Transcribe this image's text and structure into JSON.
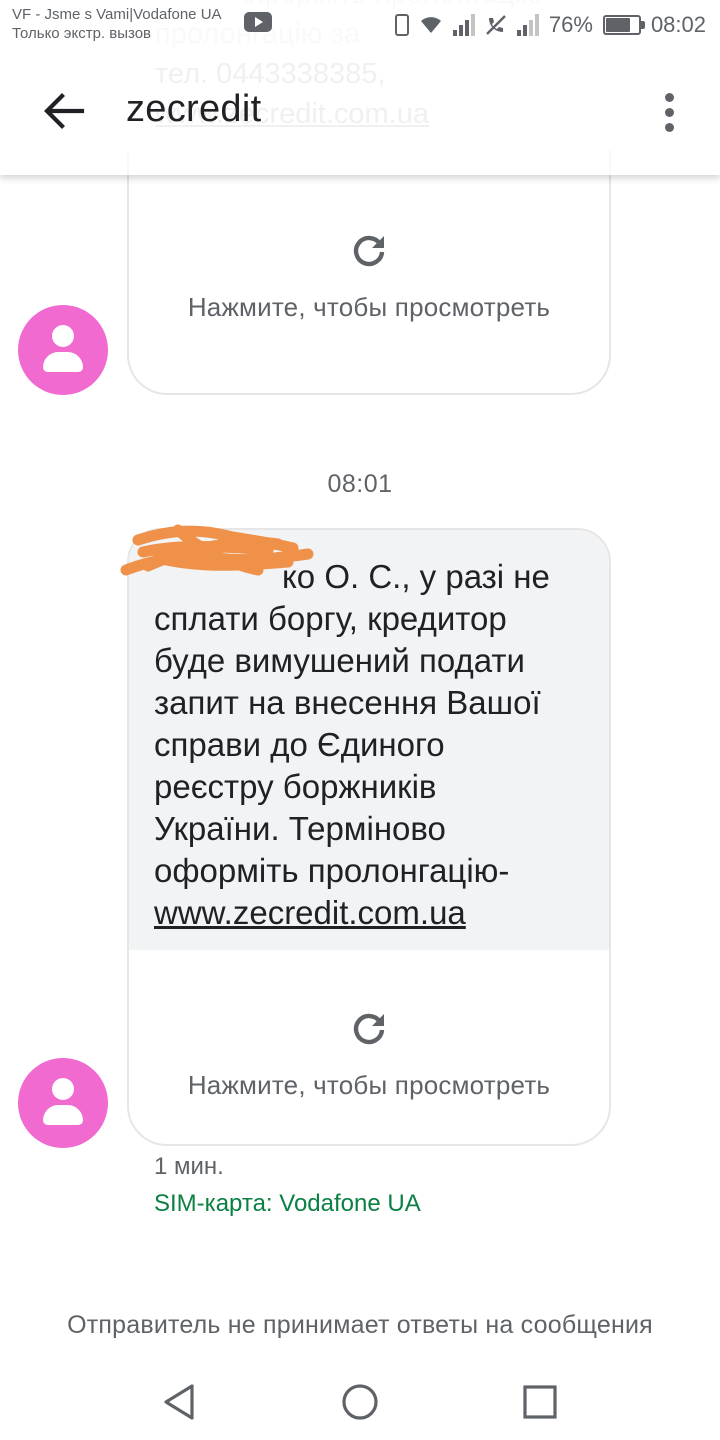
{
  "status_bar": {
    "carrier_line": "VF - Jsme s Vami|Vodafone UA",
    "emergency_line": "Только экстр. вызов",
    "battery_percent": "76%",
    "battery_level": 0.76,
    "time": "08:02",
    "icons": [
      "youtube-icon",
      "vibrate-icon",
      "wifi-icon",
      "signal-icon",
      "call-blocked-icon",
      "signal-icon",
      "battery-icon"
    ]
  },
  "app_bar": {
    "title": "zecredit",
    "back_icon": "arrow-back-icon",
    "menu_icon": "more-vert-icon"
  },
  "ghost_text": {
    "line1": "оформіть пролонгацію",
    "line2": "пролонгацію за",
    "line3": "тел. 0443338385,",
    "line4": "www.zecredit.com.ua"
  },
  "messages": [
    {
      "tap_to_view": "Нажмите, чтобы просмотреть",
      "icon": "refresh-icon",
      "avatar_icon": "person-icon",
      "avatar_color": "#f06ad0"
    },
    {
      "timestamp": "08:01",
      "lines": [
        "ко О. С., у разі не",
        "сплати боргу, кредитор",
        "буде вимушений подати",
        "запит на внесення Вашої",
        "справи до Єдиного",
        "реєстру боржників",
        "України. Терміново",
        "оформіть пролонгацію-"
      ],
      "link": "www.zecredit.com.ua",
      "tap_to_view": "Нажмите, чтобы просмотреть",
      "icon": "refresh-icon",
      "avatar_icon": "person-icon",
      "avatar_color": "#f06ad0",
      "age": "1 мин.",
      "sim": "SIM-карта: Vodafone UA"
    }
  ],
  "footer_note": "Отправитель не принимает ответы на сообщения",
  "nav_bar": {
    "icons": [
      "nav-back-icon",
      "nav-home-icon",
      "nav-recents-icon"
    ]
  },
  "colors": {
    "avatar": "#f06ad0",
    "sim_text": "#0b8043",
    "bubble_bg": "#f1f3f4",
    "redaction": "#f0914a"
  }
}
